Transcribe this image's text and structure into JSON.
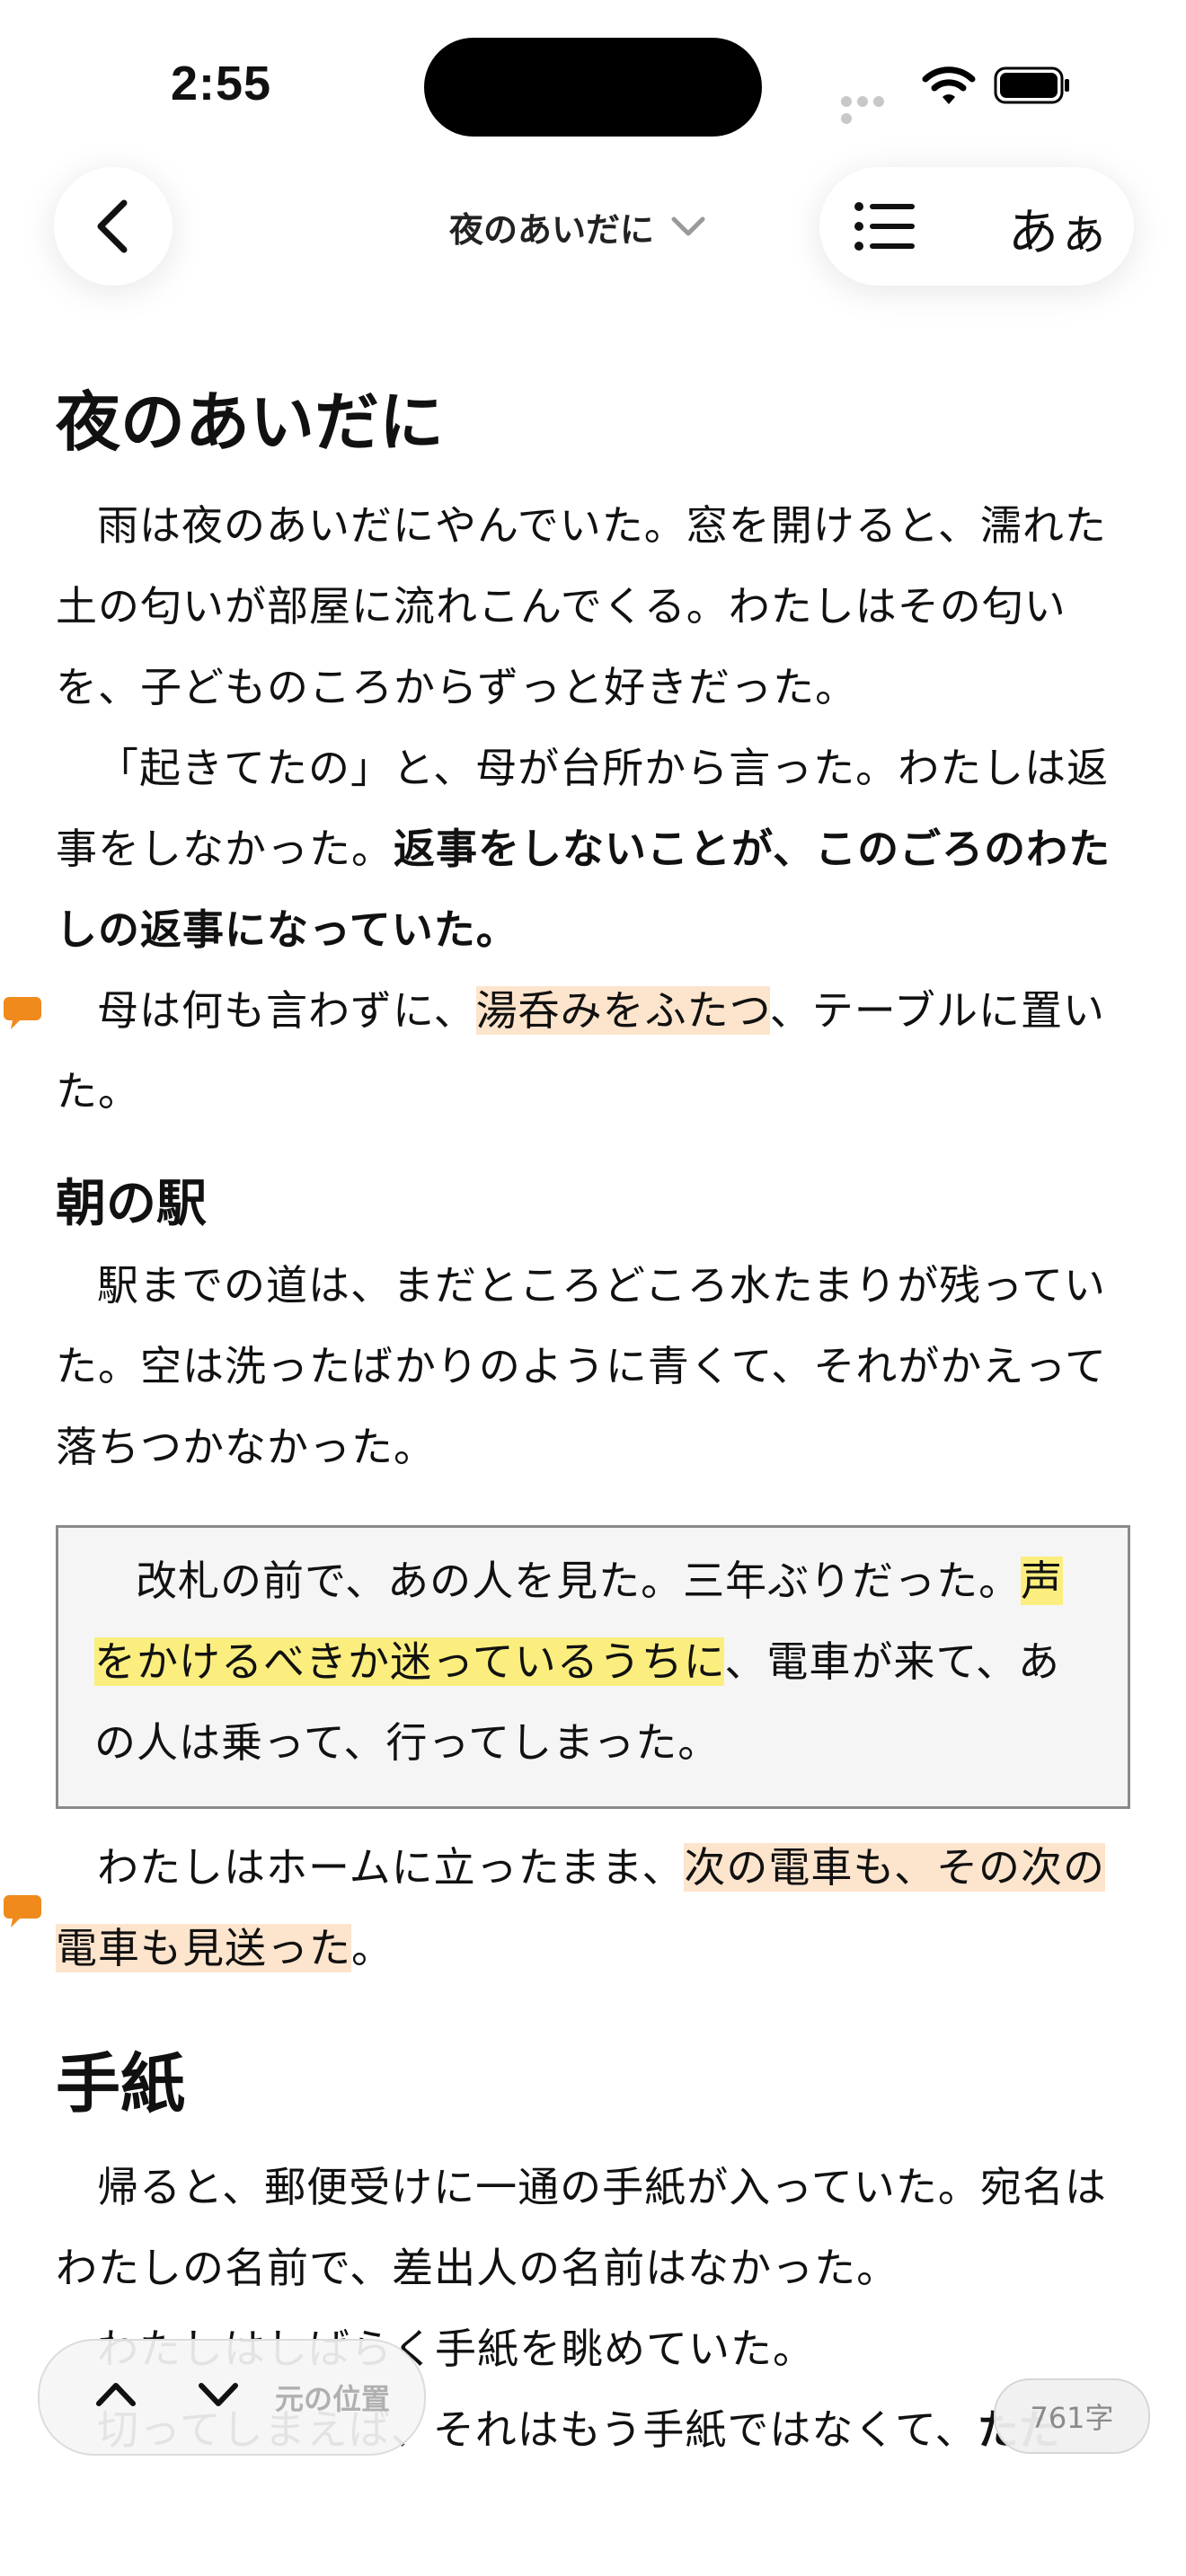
{
  "status": {
    "time": "2:55"
  },
  "nav": {
    "title": "夜のあいだに",
    "font_button": "あぁ"
  },
  "chapter1": {
    "title": "夜のあいだに",
    "p1": "雨は夜のあいだにやんでいた。窓を開けると、濡れた土の匂いが部屋に流れこんでくる。わたしはその匂いを、子どものころからずっと好きだった。",
    "p2_start": "「起きてたの」と、母が台所から言った。わたしは返事をしなかった。",
    "p2_bold": "返事をしないことが、このごろのわたしの返事になっていた。",
    "p3_start": "母は何も言わずに、",
    "p3_highlight": "湯呑みをふたつ",
    "p3_end": "、テーブルに置いた。"
  },
  "section2": {
    "title": "朝の駅",
    "p1": "駅までの道は、まだところどころ水たまりが残っていた。空は洗ったばかりのように青くて、それがかえって落ちつかなかった。",
    "quote_start": "改札の前で、あの人を見た。三年ぶりだった。",
    "quote_highlight": "声をかけるべきか迷っているうちに",
    "quote_end": "、電車が来て、あの人は乗って、行ってしまった。",
    "p2_start": "わたしはホームに立ったまま、",
    "p2_highlight": "次の電車も、その次の電車も見送った",
    "p2_end": "。"
  },
  "chapter2": {
    "title": "手紙",
    "p1": "帰ると、郵便受けに一通の手紙が入っていた。宛名はわたしの名前で、差出人の名前はなかった。",
    "p2": "わたしはしばらく手紙を眺めていた。",
    "p3_start": "切ってしまえば、それはもう手紙ではなくて、",
    "p3_bold": "ただ"
  },
  "bottom": {
    "return_label": "元の位置",
    "char_count": "761字"
  },
  "colors": {
    "highlight_orange": "#fde4cc",
    "highlight_yellow": "#fbee7e",
    "note_icon": "#f08a1c"
  },
  "icons": [
    "back-chevron-icon",
    "chevron-down-icon",
    "table-of-contents-icon",
    "note-icon",
    "up-arrow-icon",
    "down-arrow-icon",
    "wifi-icon",
    "battery-icon"
  ]
}
